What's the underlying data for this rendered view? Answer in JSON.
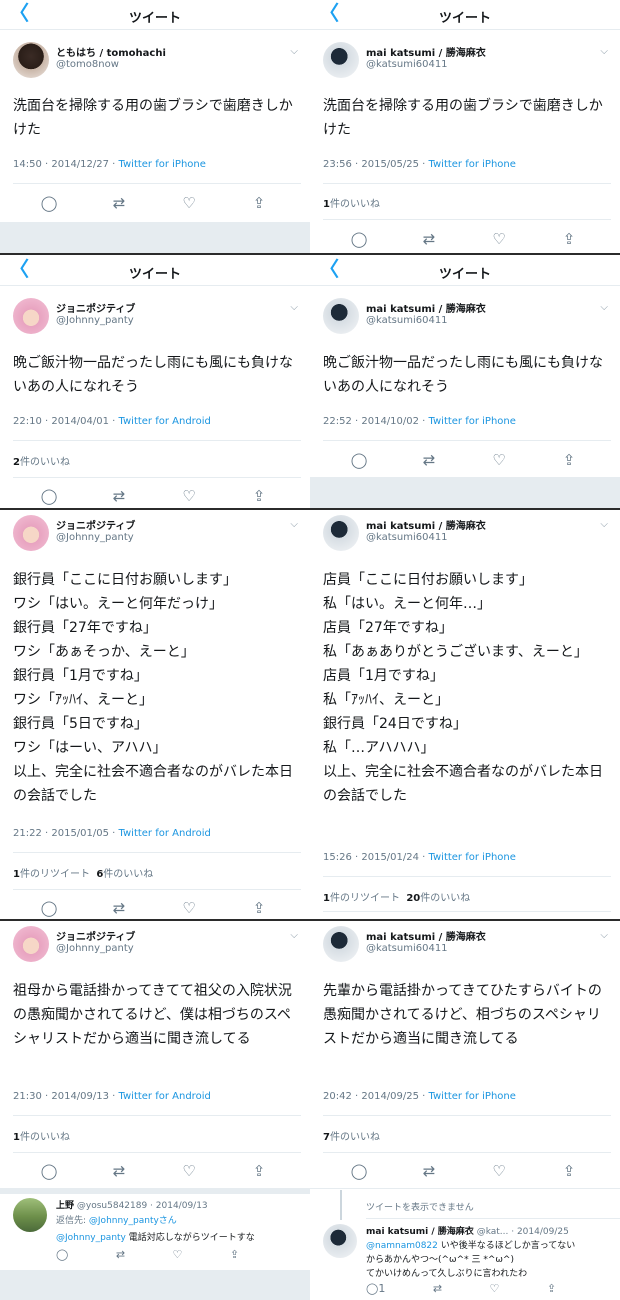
{
  "header": {
    "back_glyph": "〈",
    "title": "ツイート"
  },
  "icons": {
    "reply": "reply-icon",
    "retweet": "retweet-icon",
    "like": "heart-icon",
    "share": "share-icon",
    "chevron": "chevron-down-icon",
    "back": "back-arrow-icon"
  },
  "colors": {
    "accent": "#1da1f2",
    "link": "#1b95e0",
    "muted": "#657786",
    "divider": "#e6ecf0"
  },
  "row1": {
    "left": {
      "name": "ともはち / tomohachi",
      "handle": "@tomo8now",
      "text": "洗面台を掃除する用の歯ブラシで歯磨きしかけた",
      "time": "14:50 · 2014/12/27 · ",
      "via": "Twitter for iPhone"
    },
    "right": {
      "name": "mai katsumi / 勝海麻衣",
      "handle": "@katsumi60411",
      "text": "洗面台を掃除する用の歯ブラシで歯磨きしかけた",
      "time": "23:56 · 2015/05/25 · ",
      "via": "Twitter for iPhone",
      "likes_num": "1",
      "likes_label": "件のいいね"
    }
  },
  "row2": {
    "left": {
      "name": "ジョニポジティブ",
      "handle": "@Johnny_panty",
      "text": "晩ご飯汁物一品だったし雨にも風にも負けないあの人になれそう",
      "time": "22:10 · 2014/04/01 · ",
      "via": "Twitter for Android",
      "likes_num": "2",
      "likes_label": "件のいいね"
    },
    "right": {
      "name": "mai katsumi / 勝海麻衣",
      "handle": "@katsumi60411",
      "text": "晩ご飯汁物一品だったし雨にも風にも負けないあの人になれそう",
      "time": "22:52 · 2014/10/02 · ",
      "via": "Twitter for iPhone"
    }
  },
  "row3": {
    "left": {
      "name": "ジョニポジティブ",
      "handle": "@Johnny_panty",
      "text": "銀行員「ここに日付お願いします」\nワシ「はい。えーと何年だっけ」\n銀行員「27年ですね」\nワシ「あぁそっか、えーと」\n銀行員「1月ですね」\nワシ「ｱｯﾊｲ、えーと」\n銀行員「5日ですね」\nワシ「はーい、アハハ」\n以上、完全に社会不適合者なのがバレた本日の会話でした",
      "time": "21:22 · 2015/01/05 · ",
      "via": "Twitter for Android",
      "rt_num": "1",
      "rt_label": "件のリツイート",
      "likes_num": "6",
      "likes_label": "件のいいね"
    },
    "right": {
      "name": "mai katsumi / 勝海麻衣",
      "handle": "@katsumi60411",
      "text": "店員「ここに日付お願いします」\n私「はい。えーと何年…」\n店員「27年ですね」\n私「あぁありがとうございます、えーと」\n店員「1月ですね」\n私「ｱｯﾊｲ、えーと」\n銀行員「24日ですね」\n私「…アハハハ」\n以上、完全に社会不適合者なのがバレた本日の会話でした",
      "time": "15:26 · 2015/01/24 · ",
      "via": "Twitter for iPhone",
      "rt_num": "1",
      "rt_label": "件のリツイート",
      "likes_num": "20",
      "likes_label": "件のいいね"
    }
  },
  "row4": {
    "left": {
      "name": "ジョニポジティブ",
      "handle": "@Johnny_panty",
      "text": "祖母から電話掛かってきてて祖父の入院状況の愚痴聞かされてるけど、僕は相づちのスペシャリストだから適当に聞き流してる",
      "time": "21:30 · 2014/09/13 · ",
      "via": "Twitter for Android",
      "likes_num": "1",
      "likes_label": "件のいいね",
      "reply": {
        "name": "上野",
        "meta": "@yosu5842189 · 2014/09/13",
        "to_label": "返信先: ",
        "to_handle": "@Johnny_pantyさん",
        "mention": "@Johnny_panty",
        "text": " 電話対応しながらツイートすな"
      }
    },
    "right": {
      "name": "mai katsumi / 勝海麻衣",
      "handle": "@katsumi60411",
      "text": "先輩から電話掛かってきてひたすらバイトの愚痴聞かされてるけど、相づちのスペシャリストだから適当に聞き流してる",
      "time": "20:42 · 2014/09/25 · ",
      "via": "Twitter for iPhone",
      "likes_num": "7",
      "likes_label": "件のいいね",
      "unavailable": "ツイートを表示できません",
      "reply": {
        "name": "mai katsumi / 勝海麻衣",
        "meta": "@kat... · 2014/09/25",
        "mention": "@namnam0822",
        "line1": " いや後半なるほどしか言ってない",
        "line2": "からあかんやつ〜(^ω^* 三 *^ω^)",
        "line3": "てかいけめんって久しぶりに言われたわ",
        "reply_count": "1"
      }
    }
  }
}
